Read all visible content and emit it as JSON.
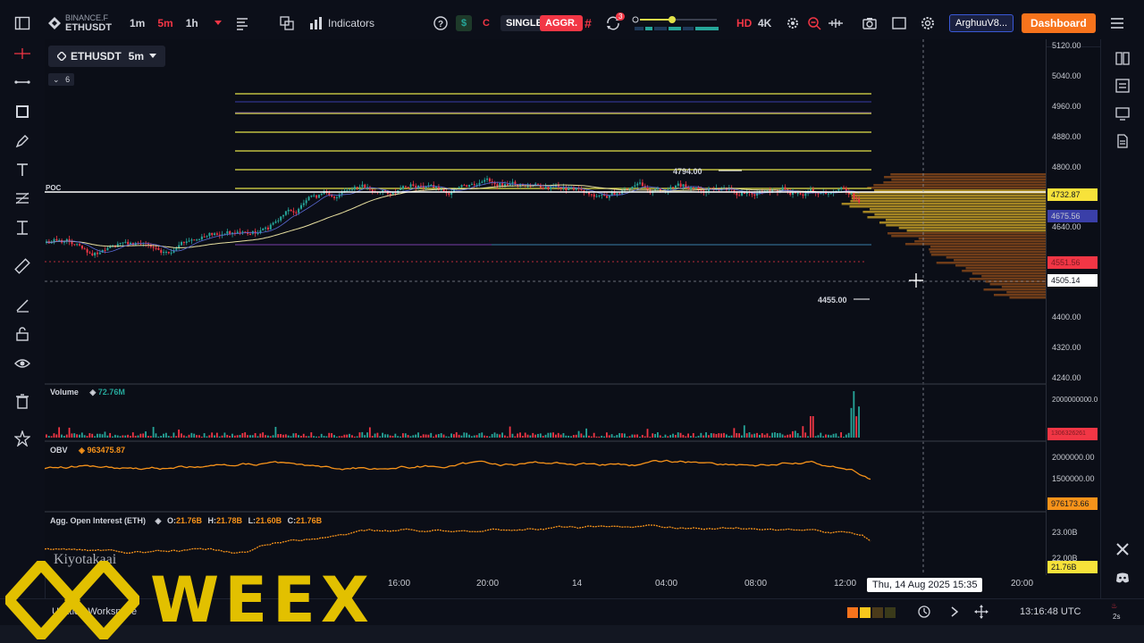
{
  "topbar": {
    "exchange": "BINANCE.F",
    "symbol": "ETHUSDT",
    "timeframes": [
      "1m",
      "5m",
      "1h"
    ],
    "active_timeframe": "5m",
    "indicators_label": "Indicators",
    "single_label": "SINGLE",
    "aggr_label": "AGGR.",
    "notification_count": "3",
    "hd_label": "HD",
    "k4_label": "4K",
    "layout_label": "ArghuuV8...",
    "dashboard_label": "Dashboard",
    "currency_s": "$",
    "currency_c": "C"
  },
  "chart": {
    "symbol_chip": "ETHUSDT",
    "interval_chip": "5m",
    "layers_count": "6",
    "poc_label": "POC",
    "high_label": "4794.00",
    "low_label": "4455.00",
    "crosshair_date": "Thu, 14 Aug 2025 15:35",
    "price_ticks": [
      "5120.00",
      "5040.00",
      "4960.00",
      "4880.00",
      "4800.00",
      "4640.00",
      "4400.00",
      "4320.00",
      "4240.00"
    ],
    "price_tags": {
      "poc": "4732.87",
      "vwap": "4675.56",
      "last": "4551.56",
      "crosshair": "4505.14"
    },
    "time_ticks": [
      "16:00",
      "20:00",
      "14",
      "04:00",
      "08:00",
      "12:00",
      "20:00"
    ],
    "colors": {
      "up": "#26a69a",
      "down": "#f23645",
      "accent": "#f7931a",
      "yellow": "#e2e24a",
      "brand": "#e2c000"
    }
  },
  "panes": {
    "volume": {
      "name": "Volume",
      "value": "72.76M",
      "tick": "2000000000.0",
      "tag": "1306326261"
    },
    "obv": {
      "name": "OBV",
      "value": "963475.87",
      "ticks": [
        "2000000.00",
        "1500000.00"
      ],
      "tag": "976173.66"
    },
    "oi": {
      "name": "Agg. Open Interest (ETH)",
      "o": "21.76B",
      "h": "21.78B",
      "l": "21.60B",
      "c": "21.76B",
      "ticks": [
        "23.00B",
        "22.00B"
      ],
      "tag": "21.76B"
    }
  },
  "bottom": {
    "workspace_label": "Untitled Workspace",
    "clock": "13:16:48 UTC",
    "sub_time": "2s",
    "watermark_brand": "WEEX",
    "watermark_author": "Kiyotakaai"
  }
}
